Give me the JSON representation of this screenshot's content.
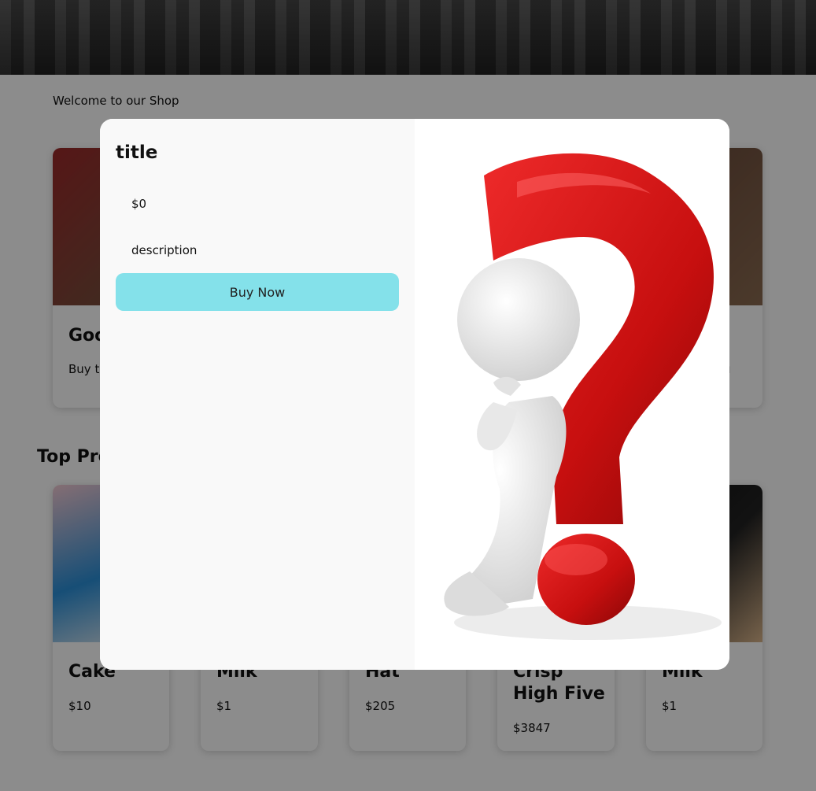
{
  "header": {
    "welcome": "Welcome to our Shop"
  },
  "featured": [
    {
      "title": "Goo",
      "text": "Buy th"
    },
    {
      "title": "",
      "text": "u"
    }
  ],
  "top_products": {
    "section_title": "Top Pro",
    "items": [
      {
        "name": "Cake",
        "price": "$10"
      },
      {
        "name": "Milk",
        "price": "$1"
      },
      {
        "name": "Hat",
        "price": "$205"
      },
      {
        "name": "Crisp High Five",
        "price": "$3847"
      },
      {
        "name": "Milk",
        "price": "$1"
      }
    ]
  },
  "modal": {
    "title": "title",
    "price": "$0",
    "description": "description",
    "buy_label": "Buy Now"
  },
  "colors": {
    "buy_button": "#84e1ea",
    "question_mark": "#d91212"
  }
}
